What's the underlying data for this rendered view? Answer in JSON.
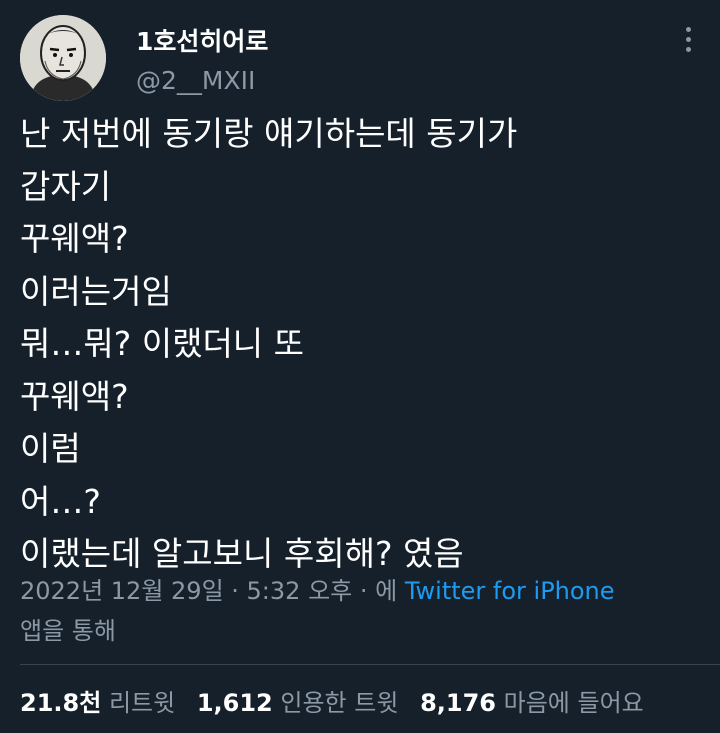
{
  "author": {
    "display_name": "1호선히어로",
    "handle": "@2__MXII"
  },
  "tweet": {
    "lines": [
      "난 저번에 동기랑 얘기하는데 동기가",
      "갑자기",
      "꾸웨액?",
      "이러는거임",
      "뭐…뭐? 이랬더니 또",
      "꾸웨액?",
      "이럼",
      "어…?",
      "이랬는데 알고보니 후회해? 였음"
    ]
  },
  "meta": {
    "timestamp": "2022년 12월 29일 · 5:32 오후 · 에 ",
    "source": "Twitter for iPhone",
    "suffix": "앱을 통해"
  },
  "stats": {
    "retweets_count": "21.8천",
    "retweets_label": "리트윗",
    "quotes_count": "1,612",
    "quotes_label": "인용한 트윗",
    "likes_count": "8,176",
    "likes_label": "마음에 들어요"
  },
  "icons": {
    "more": "more-vertical-icon"
  },
  "colors": {
    "background": "#15202b",
    "text_primary": "#ffffff",
    "text_secondary": "#8b98a5",
    "link": "#1d9bf0",
    "divider": "#38444d"
  }
}
